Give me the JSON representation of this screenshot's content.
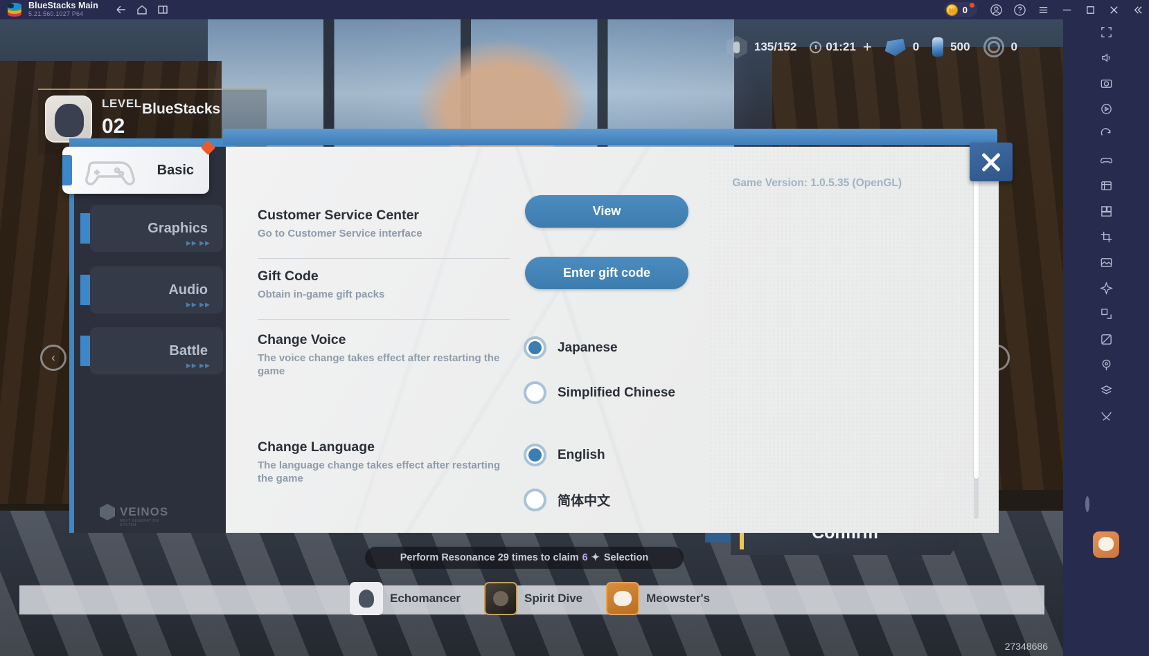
{
  "titlebar": {
    "app_title": "BlueStacks Main",
    "version": "5.21.560.1027  P64",
    "nav_icons": [
      "back-icon",
      "home-icon",
      "multi-instance-icon"
    ],
    "coin_value": "0",
    "right_icons": [
      "account-icon",
      "help-icon",
      "menu-icon",
      "minimize-icon",
      "maximize-icon",
      "close-icon",
      "collapse-icon"
    ]
  },
  "game": {
    "player": {
      "level_label": "LEVEL",
      "level_value": "02",
      "name": "BlueStacks"
    },
    "hud": {
      "stamina": "135/152",
      "timer": "01:21",
      "plus": "+",
      "currency1": "0",
      "currency2": "500",
      "currency3": "0"
    },
    "quest_banner": {
      "pre": "Perform Resonance 29 times to claim",
      "amount": "6",
      "post": "Selection"
    },
    "nav": [
      {
        "label": "Echomancer",
        "icon": "echomancer-icon"
      },
      {
        "label": "Spirit Dive",
        "icon": "spirit-dive-icon"
      },
      {
        "label": "Meowster's",
        "icon": "meowsters-icon"
      }
    ],
    "uid": "27348686",
    "arrow_left": "‹",
    "arrow_right": "›"
  },
  "settings": {
    "game_version": "Game Version: 1.0.5.35 (OpenGL)",
    "brand": {
      "name": "VEINOS",
      "sub": "NEXT GENERATION SYSTEM"
    },
    "tabs": [
      {
        "label": "Basic",
        "icon": "gamepad-icon",
        "active": true,
        "badge": true
      },
      {
        "label": "Graphics",
        "icon": "graphics-icon",
        "active": false,
        "badge": false
      },
      {
        "label": "Audio",
        "icon": "audio-icon",
        "active": false,
        "badge": false
      },
      {
        "label": "Battle",
        "icon": "battle-icon",
        "active": false,
        "badge": false
      }
    ],
    "rows": [
      {
        "name": "Customer Service Center",
        "desc": "Go to Customer Service interface",
        "button": "View"
      },
      {
        "name": "Gift Code",
        "desc": "Obtain in-game gift packs",
        "button": "Enter gift code"
      },
      {
        "name": "Change Voice",
        "desc": "The voice change takes effect after restarting the game",
        "options": [
          {
            "label": "Japanese",
            "selected": true
          },
          {
            "label": "Simplified Chinese",
            "selected": false
          }
        ]
      },
      {
        "name": "Change Language",
        "desc": "The language change takes effect after restarting the game",
        "options": [
          {
            "label": "English",
            "selected": true
          },
          {
            "label": "简体中文",
            "selected": false
          }
        ]
      }
    ],
    "close_icon": "close-icon"
  },
  "confirm_button": {
    "label": "Confirm"
  },
  "colors": {
    "titlebar_bg": "#272b4d",
    "accent_blue": "#3c87c9",
    "button_blue": "#4b8cc0",
    "badge_red": "#f05a28",
    "panel_bg": "#eceded"
  }
}
